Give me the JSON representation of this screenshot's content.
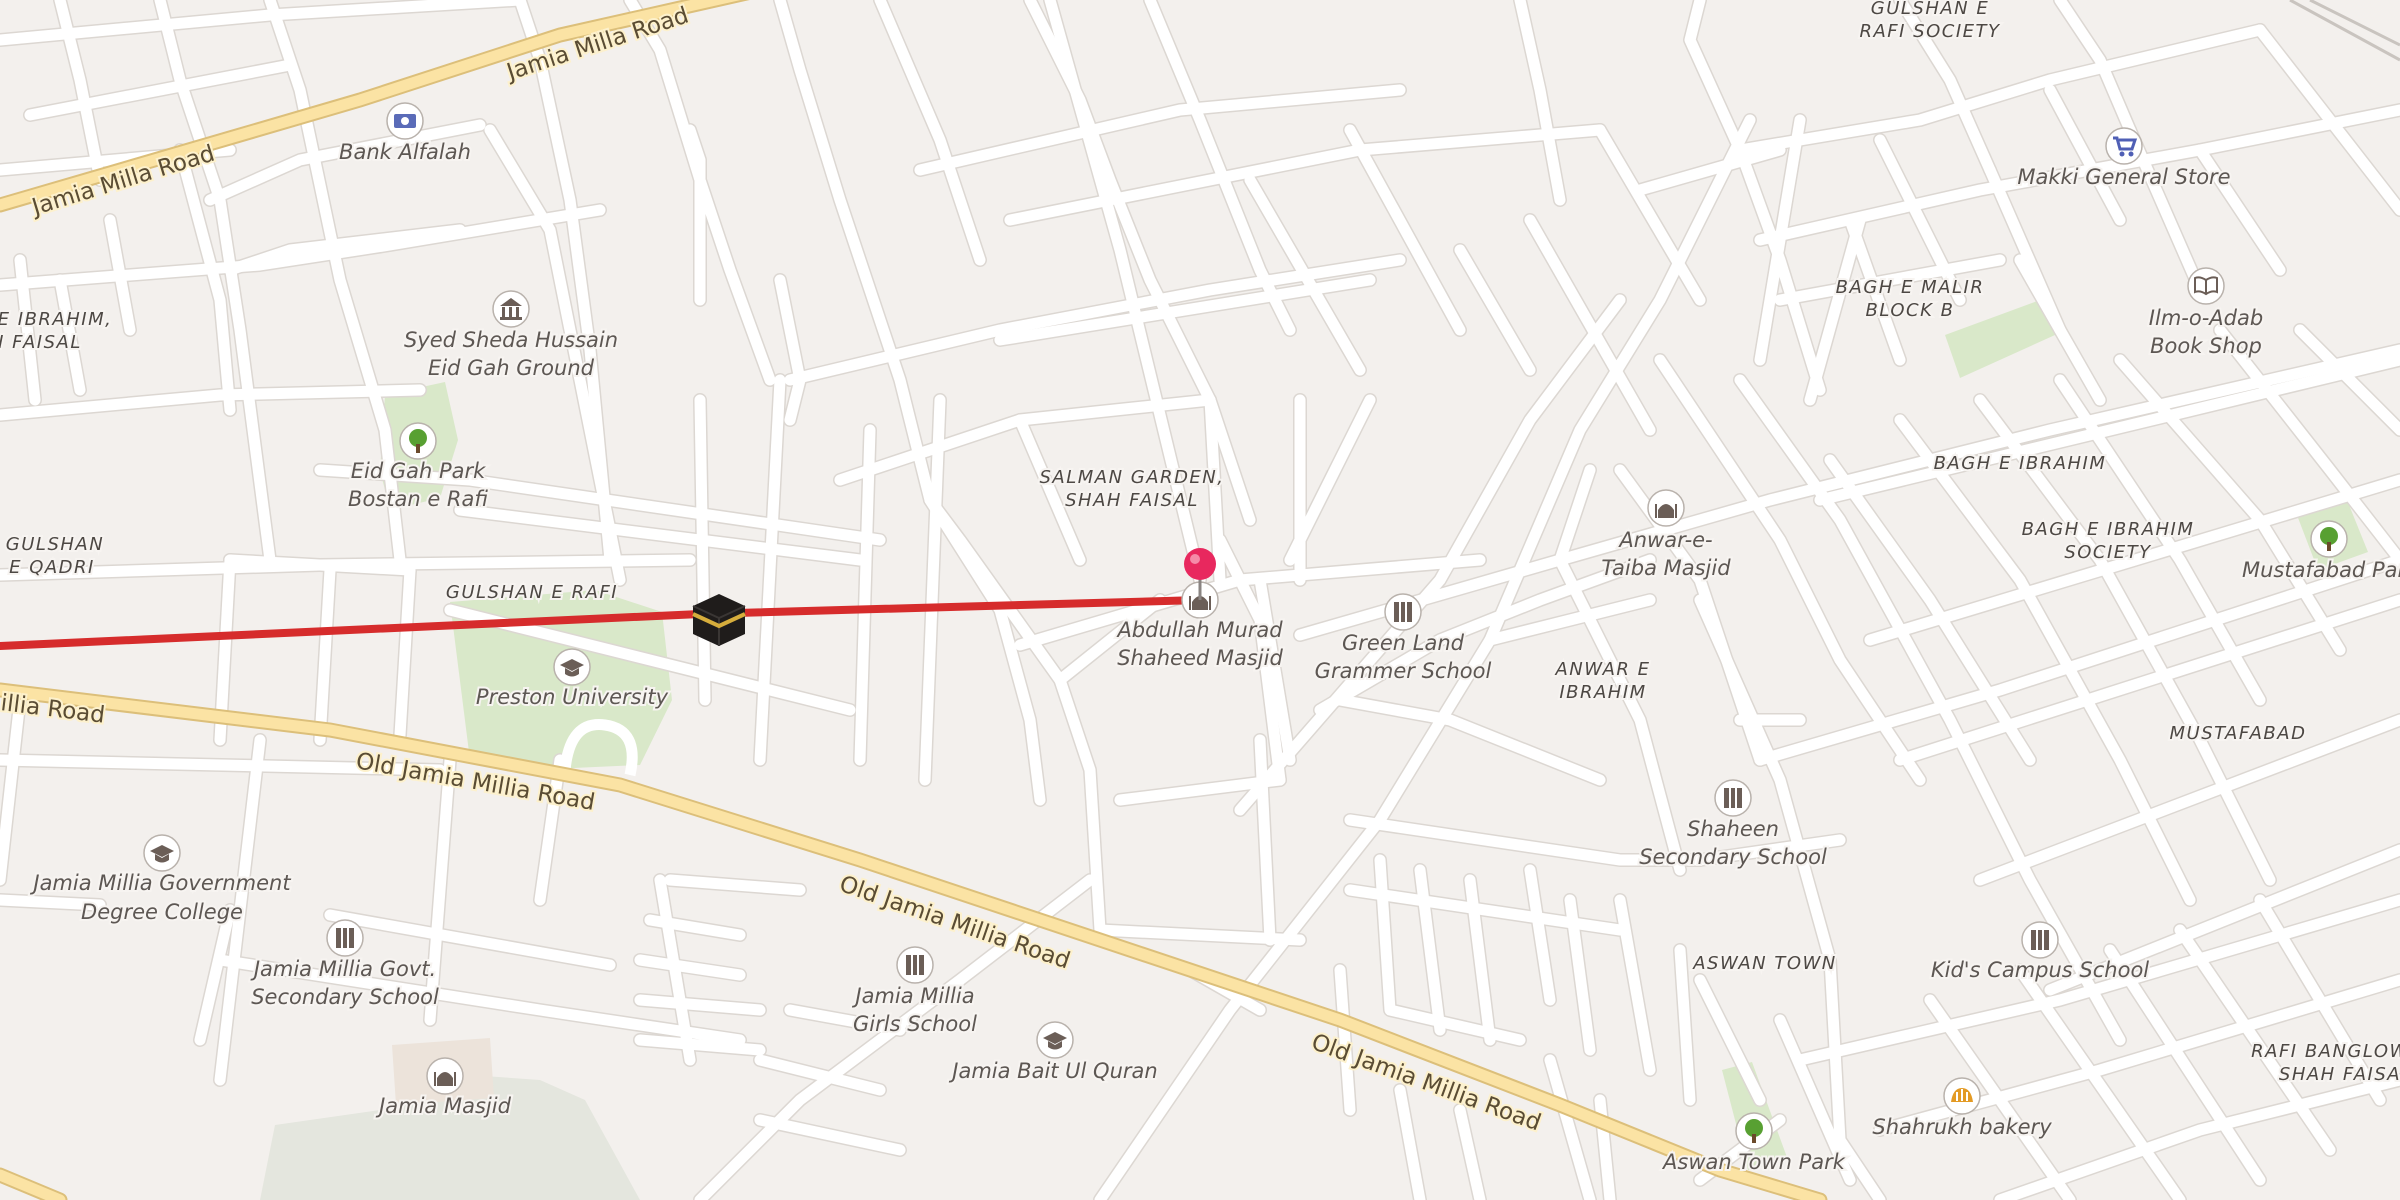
{
  "map": {
    "road_labels": [
      "Jamia Milla Road",
      "Jamia Milla Road",
      "Old Jamia Millia Road",
      "Old Jamia Millia Road",
      "Old Jamia Millia Road",
      "illia Road"
    ],
    "area_labels": [
      "GULSHAN E",
      "RAFI SOCIETY",
      "E IBRAHIM,",
      "I FAISAL",
      "GULSHAN",
      "E QADRI",
      "GULSHAN E RAFI",
      "SALMAN GARDEN,",
      "SHAH FAISAL",
      "BAGH E MALIR",
      "BLOCK B",
      "BAGH E IBRAHIM",
      "BAGH E IBRAHIM",
      "SOCIETY",
      "ANWAR E",
      "IBRAHIM",
      "MUSTAFABAD",
      "ASWAN TOWN",
      "RAFI BANGLOW",
      "SHAH FAISA"
    ],
    "pois": [
      {
        "name": "Bank Alfalah",
        "icon": "bank-note-icon"
      },
      {
        "name": "Syed Sheda Hussain",
        "name2": "Eid Gah Ground",
        "icon": "landmark-icon"
      },
      {
        "name": "Eid Gah Park",
        "name2": "Bostan e Rafi",
        "icon": "tree-icon"
      },
      {
        "name": "Preston University",
        "icon": "graduation-cap-icon"
      },
      {
        "name": "Jamia Millia Government",
        "name2": "Degree College",
        "icon": "graduation-cap-icon"
      },
      {
        "name": "Jamia Millia Govt.",
        "name2": "Secondary School",
        "icon": "school-icon"
      },
      {
        "name": "Jamia Masjid",
        "icon": "mosque-icon"
      },
      {
        "name": "Jamia Millia",
        "name2": "Girls School",
        "icon": "school-icon"
      },
      {
        "name": "Jamia Bait Ul Quran",
        "icon": "graduation-cap-icon"
      },
      {
        "name": "Abdullah Murad",
        "name2": "Shaheed Masjid",
        "icon": "mosque-icon"
      },
      {
        "name": "Green Land",
        "name2": "Grammer School",
        "icon": "school-icon"
      },
      {
        "name": "Anwar-e-",
        "name2": "Taiba Masjid",
        "icon": "mosque-icon"
      },
      {
        "name": "Shaheen",
        "name2": "Secondary School",
        "icon": "school-icon"
      },
      {
        "name": "Kid's Campus School",
        "icon": "school-icon"
      },
      {
        "name": "Makki General Store",
        "icon": "shopping-cart-icon"
      },
      {
        "name": "Ilm-o-Adab",
        "name2": "Book Shop",
        "icon": "book-icon"
      },
      {
        "name": "Mustafabad Par",
        "icon": "tree-icon"
      },
      {
        "name": "Aswan Town Park",
        "icon": "tree-icon"
      },
      {
        "name": "Shahrukh bakery",
        "icon": "bakery-icon"
      }
    ],
    "colors": {
      "background": "#f3f0ed",
      "route_line": "#d62c2c",
      "pin": "#e8285e",
      "park": "#d9e8c9",
      "major_road": "#fbe3a4"
    },
    "markers": {
      "destination_pin": "map-pin-icon",
      "kaaba": "kaaba-icon"
    }
  }
}
